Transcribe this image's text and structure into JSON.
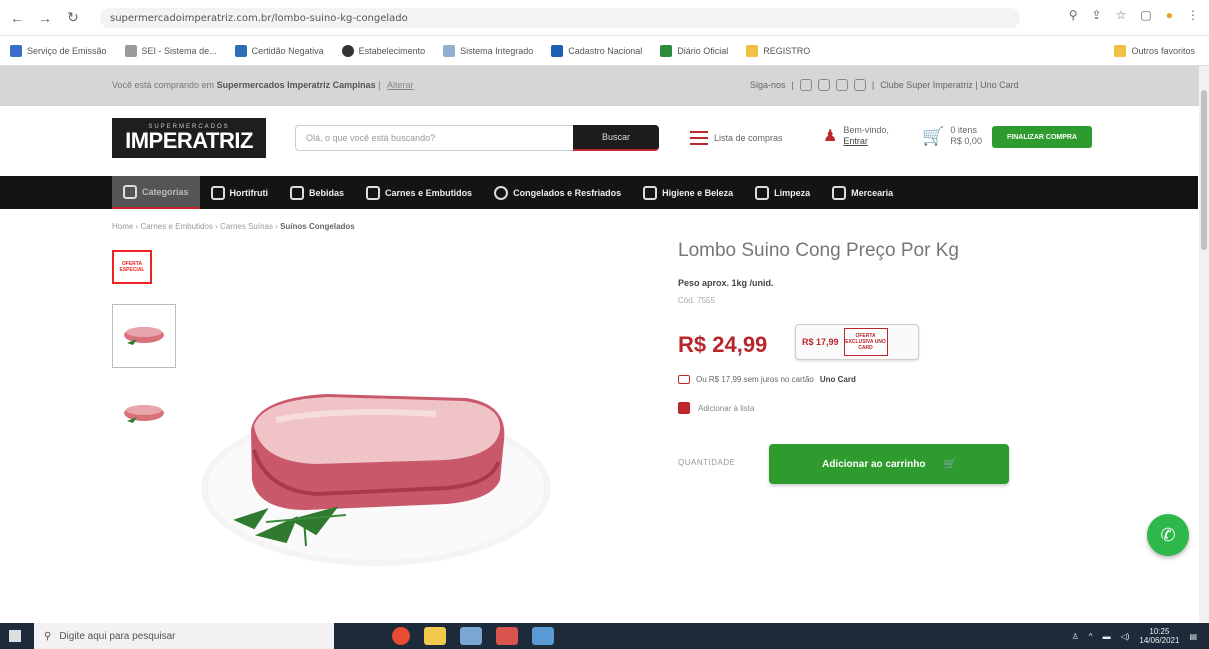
{
  "browser": {
    "url": "supermercadoimperatriz.com.br/lombo-suino-kg-congelado",
    "bookmarks": [
      "Serviço de Emissão",
      "SEI - Sistema de...",
      "Certidão Negativa",
      "Estabelecimento",
      "Sistema Integrado",
      "Cadastro Nacional",
      "Diário Oficial",
      "REGISTRO",
      "Outros favoritos"
    ]
  },
  "topbar": {
    "notice_prefix": "Você está comprando em",
    "notice_store": "Supermercados Imperatriz Campinas",
    "notice_link": "Alterar",
    "right_text": "Siga-nos",
    "right_links": "Clube Super Imperatriz | Uno Card"
  },
  "header": {
    "logo_small": "SUPERMERCADOS",
    "logo_main": "IMPERATRIZ",
    "search_placeholder": "Olá, o que você está buscando?",
    "search_button": "Buscar",
    "shopping_list": "Lista de compras",
    "greeting": "Bem-vindo,",
    "login": "Entrar",
    "cart_label": "0 itens",
    "cart_total": "R$ 0,00",
    "checkout_button": "FINALIZAR COMPRA"
  },
  "categories": [
    {
      "label": "Categorias",
      "active": true
    },
    {
      "label": "Hortifruti",
      "active": false
    },
    {
      "label": "Bebidas",
      "active": false
    },
    {
      "label": "Carnes e Embutidos",
      "active": false
    },
    {
      "label": "Congelados e Resfriados",
      "active": false
    },
    {
      "label": "Higiene e Beleza",
      "active": false
    },
    {
      "label": "Limpeza",
      "active": false
    },
    {
      "label": "Mercearia",
      "active": false
    }
  ],
  "breadcrumb": {
    "items": [
      "Home",
      "Carnes e Embutidos",
      "Carnes Suínas"
    ],
    "current": "Suínos Congelados"
  },
  "gallery": {
    "badge_text": "OFERTA ESPECIAL"
  },
  "product": {
    "title": "Lombo Suino Cong Preço Por Kg",
    "weight": "Peso aprox. 1kg /unid.",
    "sku": "Cód. 7555",
    "price": "R$ 24,99",
    "card_price": "R$ 17,99",
    "card_badge": "OFERTA EXCLUSIVA UNO CARD",
    "card_note_prefix": "Ou R$ 17,99 sem juros no cartão",
    "card_note_brand": "Uno Card",
    "add_to_list": "Adicionar à lista",
    "quantity_label": "QUANTIDADE",
    "add_to_cart": "Adicionar ao carrinho"
  },
  "taskbar": {
    "search_placeholder": "Digite aqui para pesquisar",
    "time": "10:25",
    "date": "14/06/2021"
  },
  "colors": {
    "brand_red": "#b8262c",
    "cta_green": "#2e9b2e",
    "nav_dark": "#141414"
  }
}
